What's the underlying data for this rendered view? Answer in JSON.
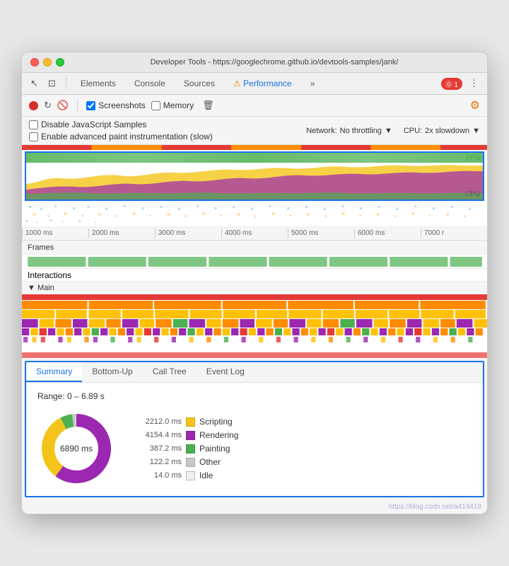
{
  "window": {
    "title": "Developer Tools - https://googlechrome.github.io/devtools-samples/jank/"
  },
  "toolbar": {
    "tabs": [
      {
        "label": "Elements",
        "active": false
      },
      {
        "label": "Console",
        "active": false
      },
      {
        "label": "Sources",
        "active": false
      },
      {
        "label": "Performance",
        "active": true
      },
      {
        "label": "»",
        "active": false
      }
    ],
    "error_badge": "⓪ 1",
    "more_icon": "⋮"
  },
  "record_bar": {
    "screenshots_label": "Screenshots",
    "memory_label": "Memory"
  },
  "options": {
    "disable_js_label": "Disable JavaScript Samples",
    "enable_paint_label": "Enable advanced paint instrumentation (slow)",
    "network_label": "Network:",
    "network_value": "No throttling",
    "cpu_label": "CPU:",
    "cpu_value": "2x slowdown"
  },
  "ruler": {
    "ticks": [
      "1000 ms",
      "2000 ms",
      "3000 ms",
      "4000 ms",
      "5000 ms",
      "6000 ms",
      "7000 r"
    ]
  },
  "timeline": {
    "fps_label": "FPS",
    "cpu_label": "CPU",
    "frames_label": "Frames",
    "interactions_label": "Interactions",
    "main_label": "▼ Main"
  },
  "bottom_panel": {
    "tabs": [
      "Summary",
      "Bottom-Up",
      "Call Tree",
      "Event Log"
    ],
    "active_tab": "Summary",
    "range_text": "Range: 0 – 6.89 s",
    "donut_label": "6890 ms",
    "legend": [
      {
        "value": "2212.0 ms",
        "label": "Scripting",
        "color": "#f4c518"
      },
      {
        "value": "4154.4 ms",
        "label": "Rendering",
        "color": "#9c27b0"
      },
      {
        "value": "387.2 ms",
        "label": "Painting",
        "color": "#4caf50"
      },
      {
        "value": "122.2 ms",
        "label": "Other",
        "color": "#c8c8c8"
      },
      {
        "value": "14.0 ms",
        "label": "Idle",
        "color": "#ffffff"
      }
    ]
  },
  "watermark": {
    "text": "https://blog.csdn.net/a419419"
  },
  "colors": {
    "accent_blue": "#1a73e8",
    "scripting": "#f4c518",
    "rendering": "#9c27b0",
    "painting": "#4caf50",
    "other": "#c8c8c8",
    "idle": "#f0f0f0",
    "flame_orange": "#ff8c00",
    "flame_yellow": "#ffc107",
    "flame_red": "#e53935"
  }
}
